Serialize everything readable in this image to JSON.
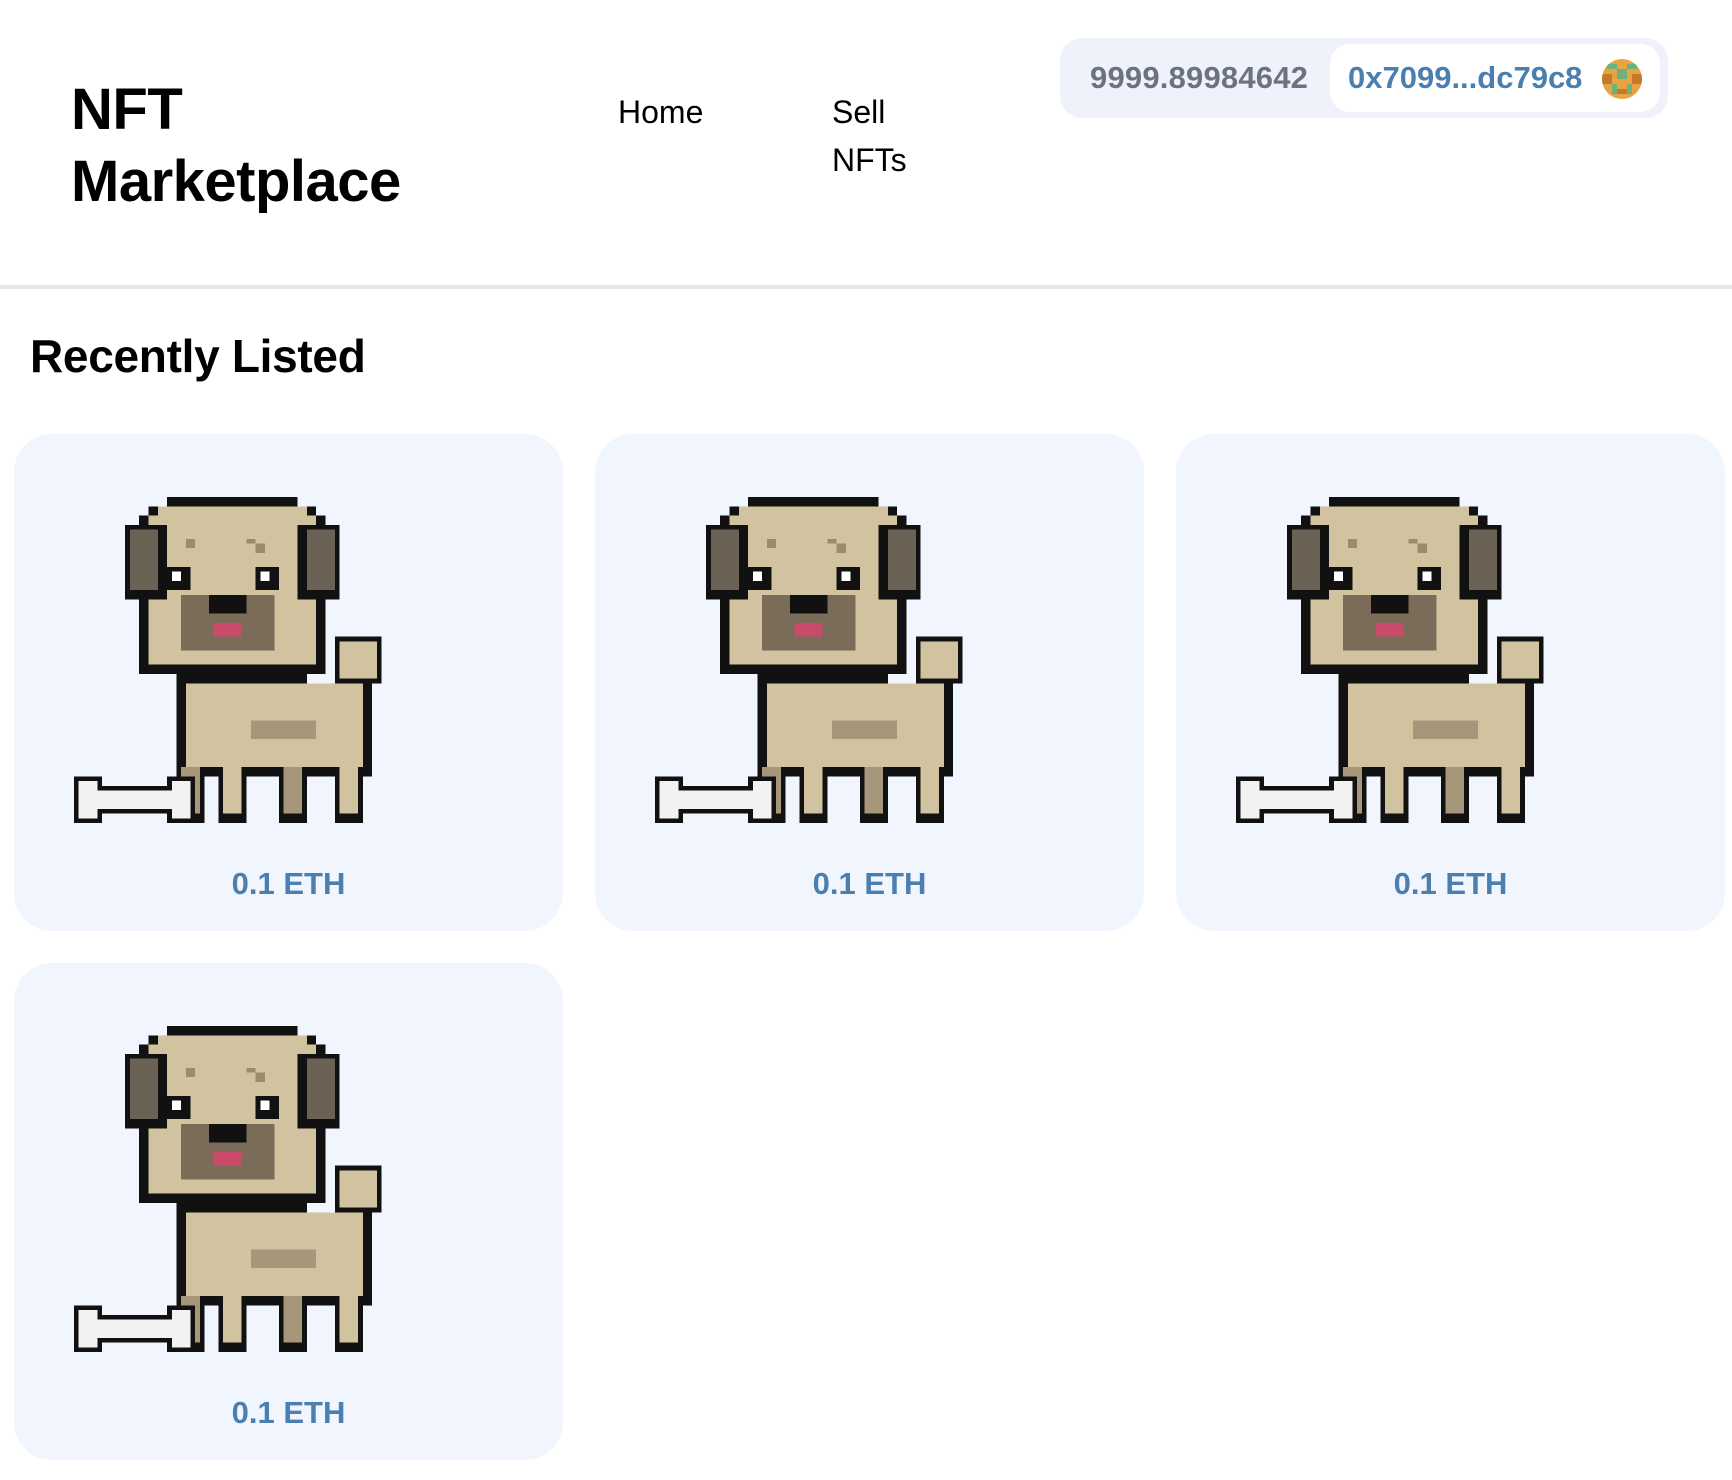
{
  "header": {
    "brand": "NFT Marketplace",
    "nav": {
      "home": "Home",
      "sell": "Sell NFTs"
    }
  },
  "wallet": {
    "balance": "9999.89984642",
    "address": "0x7099...dc79c8",
    "avatar_icon": "wallet-avatar-icon"
  },
  "main": {
    "title": "Recently Listed",
    "listings": [
      {
        "price": "0.1 ETH",
        "image_icon": "pug-nft-icon"
      },
      {
        "price": "0.1 ETH",
        "image_icon": "pug-nft-icon"
      },
      {
        "price": "0.1 ETH",
        "image_icon": "pug-nft-icon"
      },
      {
        "price": "0.1 ETH",
        "image_icon": "pug-nft-icon"
      }
    ]
  },
  "colors": {
    "card_background": "#f1f5fe",
    "price_text": "#4a7faf",
    "balance_text": "#6b7280",
    "wallet_background": "#eff2fb"
  }
}
